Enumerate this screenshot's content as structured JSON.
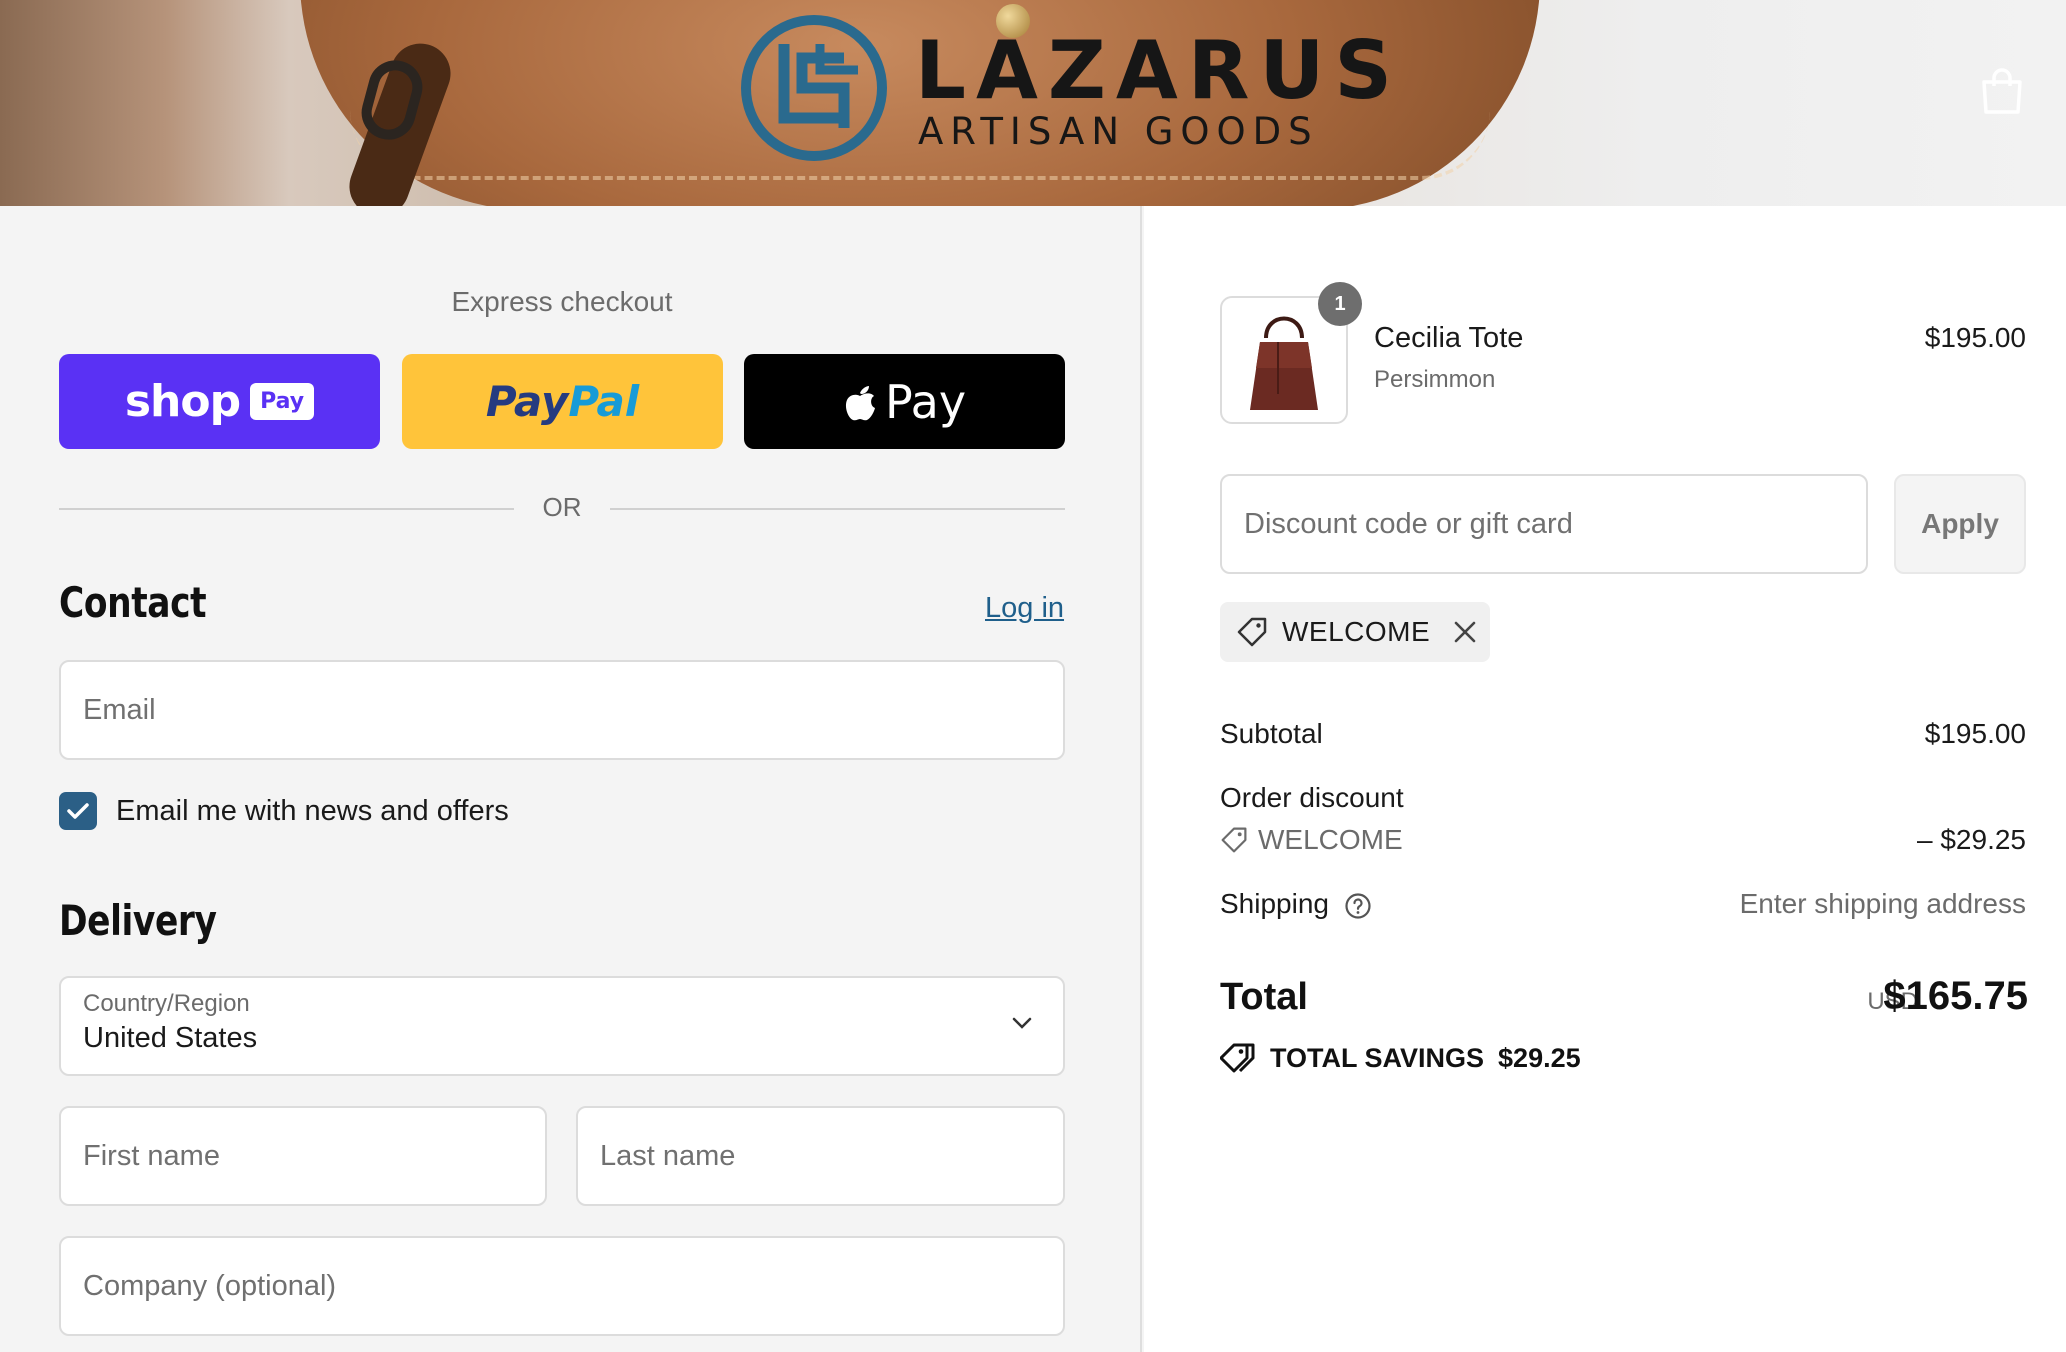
{
  "brand": {
    "name": "LAZARUS",
    "tagline": "ARTISAN GOODS",
    "colors": {
      "logo_mark": "#2a6a8e",
      "text": "#161616"
    }
  },
  "header": {
    "cart_icon": "shopping-bag-icon"
  },
  "express": {
    "title": "Express checkout",
    "shop_pay": {
      "word": "shop",
      "chip": "Pay",
      "color": "#5a31f4"
    },
    "paypal": {
      "pay": "Pay",
      "pal": "Pal",
      "color": "#ffc43a"
    },
    "apple_pay": {
      "label": "Pay",
      "color": "#000000"
    },
    "or_text": "OR"
  },
  "contact": {
    "title": "Contact",
    "login_link": "Log in",
    "email_placeholder": "Email",
    "newsletter_label": "Email me with news and offers",
    "newsletter_checked": true
  },
  "delivery": {
    "title": "Delivery",
    "country_label": "Country/Region",
    "country_value": "United States",
    "first_name_placeholder": "First name",
    "last_name_placeholder": "Last name",
    "company_placeholder": "Company (optional)"
  },
  "order": {
    "item": {
      "quantity": "1",
      "name": "Cecilia Tote",
      "variant": "Persimmon",
      "price": "$195.00"
    },
    "discount_placeholder": "Discount code or gift card",
    "apply_label": "Apply",
    "applied_code": "WELCOME",
    "subtotal_label": "Subtotal",
    "subtotal_value": "$195.00",
    "order_discount_label": "Order discount",
    "order_discount_code": "WELCOME",
    "order_discount_value": "– $29.25",
    "shipping_label": "Shipping",
    "shipping_value": "Enter shipping address",
    "total_label": "Total",
    "total_currency": "USD",
    "total_value": "$165.75",
    "savings_label": "TOTAL SAVINGS",
    "savings_value": "$29.25"
  },
  "accent_color": "#2b5f86"
}
